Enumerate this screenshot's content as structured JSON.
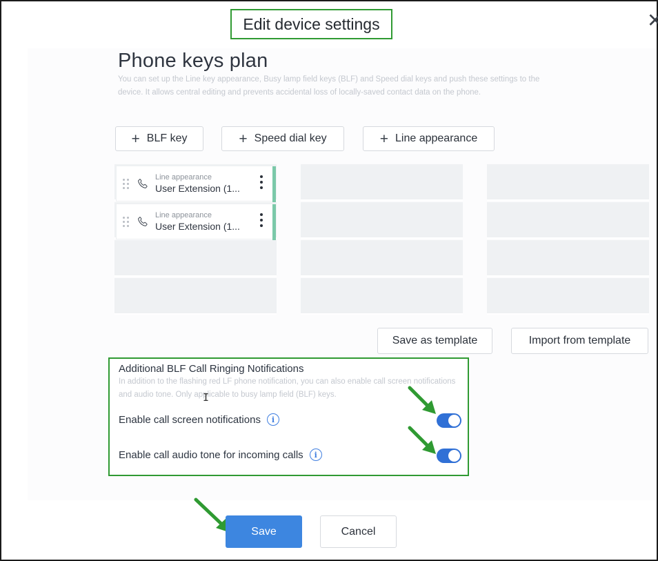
{
  "dialog": {
    "title": "Edit device settings",
    "close_icon": "close-icon"
  },
  "plan": {
    "heading": "Phone keys plan",
    "description": "You can set up the Line key appearance, Busy lamp field keys (BLF) and Speed dial keys and push these settings to the device. It allows central editing and prevents accidental loss of locally-saved contact data on the phone."
  },
  "add_buttons": {
    "blf": "BLF key",
    "speed_dial": "Speed dial key",
    "line_appearance": "Line appearance"
  },
  "keys": [
    {
      "type": "Line appearance",
      "name": "User Extension (1..."
    },
    {
      "type": "Line appearance",
      "name": "User Extension (1..."
    }
  ],
  "template_buttons": {
    "save": "Save as template",
    "import": "Import from template"
  },
  "notifications": {
    "title": "Additional BLF Call Ringing Notifications",
    "description": "In addition to the flashing red LF phone notification, you can also enable call screen notifications and audio tone. Only applicable to busy lamp field (BLF) keys.",
    "options": [
      {
        "label": "Enable call screen notifications",
        "enabled": true
      },
      {
        "label": "Enable call audio tone for incoming calls",
        "enabled": true
      }
    ]
  },
  "footer": {
    "save": "Save",
    "cancel": "Cancel"
  },
  "colors": {
    "annotation_green": "#2f9a32",
    "primary_blue": "#3d86e0",
    "toggle_blue": "#3070d6",
    "key_accent": "#7bc9a9"
  }
}
